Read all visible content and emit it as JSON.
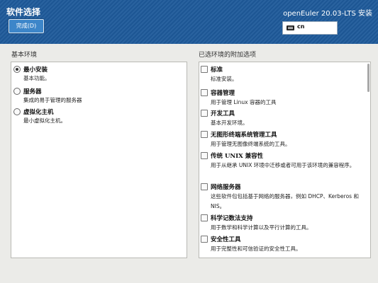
{
  "header": {
    "spoke_title": "软件选择",
    "done_label": "完成(D)",
    "product_title": "openEuler 20.03-LTS 安装",
    "keyboard_layout": "cn",
    "background_color": "#1e5a9a"
  },
  "base_environment": {
    "label": "基本环境",
    "items": [
      {
        "name": "最小安装",
        "desc": "基本功能。",
        "selected": true
      },
      {
        "name": "服务器",
        "desc": "集成的易于管理的服务器",
        "selected": false
      },
      {
        "name": "虚拟化主机",
        "desc": "最小虚拟化主机。",
        "selected": false
      }
    ]
  },
  "addons": {
    "label": "已选环境的附加选项",
    "items": [
      {
        "name": "标准",
        "desc": "标准安装。"
      },
      {
        "name": "容器管理",
        "desc": "用于管理 Linux 容器的工具"
      },
      {
        "name": "开发工具",
        "desc": "基本开发环境。"
      },
      {
        "name": "无图形终端系统管理工具",
        "desc": "用于管理无图像终端系统的工具。"
      },
      {
        "name": "传统 UNIX 兼容性",
        "desc": "用于从继承 UNIX 环境中迁移或者可用于该环境的兼容程序。"
      },
      {
        "name": "网络服务器",
        "desc": "这些软件包包括基于网络的服务器，例如 DHCP、Kerberos 和 NIS。"
      },
      {
        "name": "科学记数法支持",
        "desc": "用于数学和科学计算以及平行计算的工具。"
      },
      {
        "name": "安全性工具",
        "desc": "用于完整性和可信验证的安全性工具。"
      }
    ]
  }
}
